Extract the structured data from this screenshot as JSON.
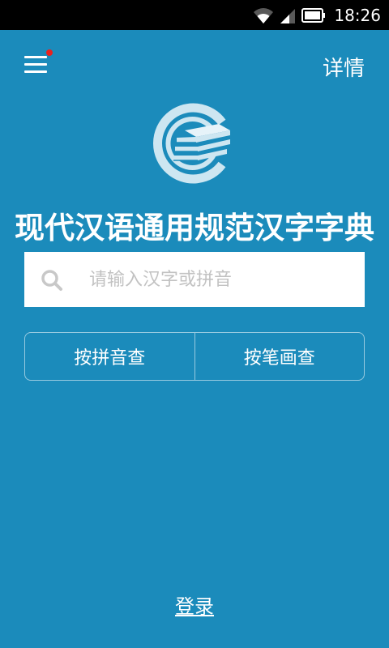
{
  "status_bar": {
    "time": "18:26",
    "icons": [
      "wifi-icon",
      "signal-icon",
      "battery-icon"
    ]
  },
  "header": {
    "menu_icon": "hamburger-menu-icon",
    "has_notification_dot": true,
    "details_label": "详情"
  },
  "logo": {
    "icon": "book-stack-logo-icon"
  },
  "title": "现代汉语通用规范汉字字典",
  "search": {
    "placeholder": "请输入汉字或拼音",
    "value": "",
    "icon": "search-icon"
  },
  "query_buttons": {
    "pinyin_label": "按拼音查",
    "stroke_label": "按笔画查"
  },
  "footer": {
    "login_label": "登录"
  },
  "colors": {
    "background": "#1b8bbb",
    "status_bar": "#000000",
    "notification_dot": "#e8221f",
    "text": "#ffffff",
    "placeholder": "#c2c2c2"
  }
}
